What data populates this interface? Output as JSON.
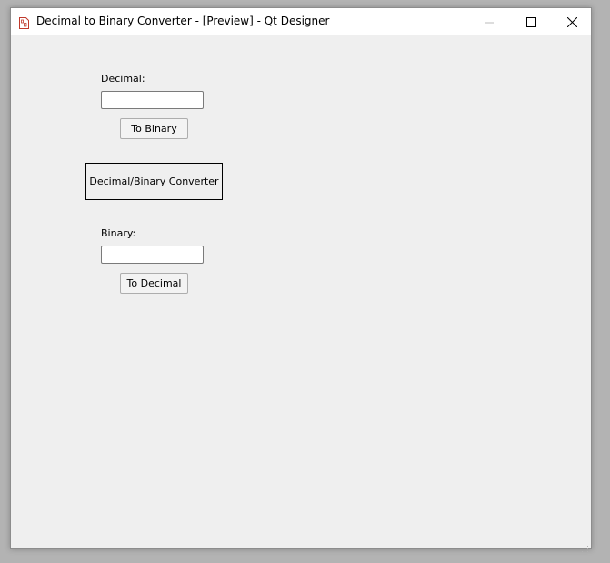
{
  "window": {
    "title": "Decimal to Binary Converter - [Preview] - Qt Designer",
    "app_icon": "qt-designer-form-icon",
    "controls": {
      "minimize_icon": "minimize-icon",
      "maximize_icon": "maximize-icon",
      "close_icon": "close-icon"
    }
  },
  "form": {
    "decimal_label": "Decimal:",
    "decimal_value": "",
    "to_binary_label": "To Binary",
    "heading": "Decimal/Binary Converter",
    "binary_label": "Binary:",
    "binary_value": "",
    "to_decimal_label": "To Decimal"
  },
  "colors": {
    "window_bg": "#efefef",
    "titlebar_bg": "#ffffff",
    "desktop_bg": "#b3b3b3"
  }
}
